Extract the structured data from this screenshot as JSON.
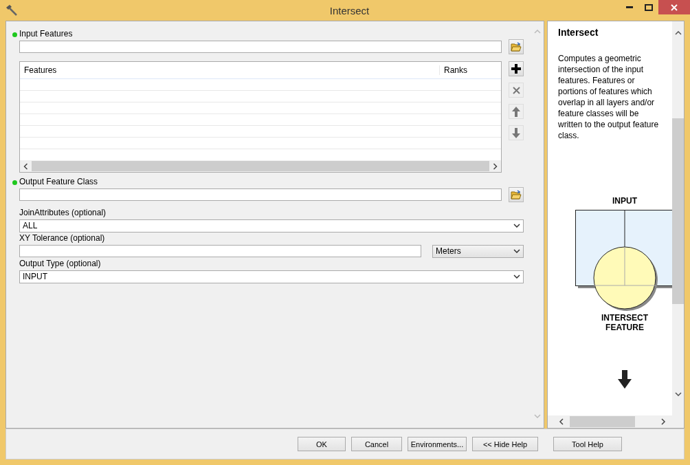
{
  "window": {
    "title": "Intersect"
  },
  "parameters": [
    {
      "kind": "multivalue",
      "label": "Input Features",
      "required": true,
      "columns": [
        "Features",
        "Ranks"
      ],
      "list_buttons": [
        {
          "kind": "add",
          "disabled": false
        },
        {
          "kind": "remove",
          "disabled": true
        },
        {
          "kind": "up",
          "disabled": true
        },
        {
          "kind": "down",
          "disabled": true
        }
      ]
    },
    {
      "kind": "dataset",
      "label": "Output Feature Class",
      "required": true
    },
    {
      "kind": "dropdown",
      "label": "JoinAttributes (optional)",
      "required": false,
      "value": "ALL"
    },
    {
      "kind": "linear",
      "label": "XY Tolerance (optional)",
      "required": false,
      "unit": "Meters"
    },
    {
      "kind": "dropdown",
      "label": "Output Type (optional)",
      "required": false,
      "value": "INPUT"
    }
  ],
  "help": {
    "title": "Intersect",
    "text": "Computes a geometric intersection of the input features. Features or portions of features which overlap in all layers and/or feature classes will be written to the output feature class.",
    "diagram_top_label": "INPUT",
    "diagram_bottom_label": "INTERSECT FEATURE"
  },
  "buttons": [
    "OK",
    "Cancel",
    "Environments...",
    "<< Hide Help",
    "Tool Help"
  ]
}
